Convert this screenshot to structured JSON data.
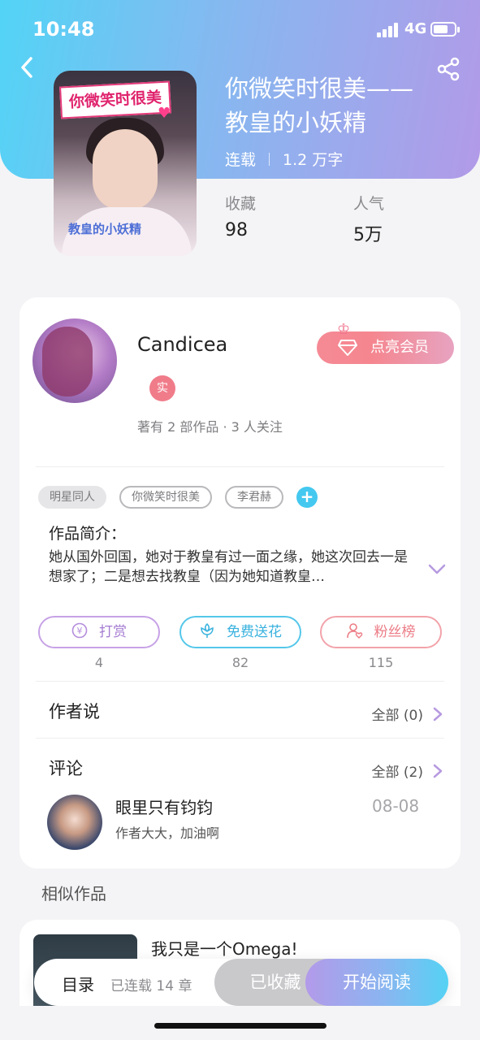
{
  "status_bar": {
    "time": "10:48",
    "network": "4G"
  },
  "book": {
    "title": "你微笑时很美——教皇的小妖精",
    "cover_banner": "你微笑时很美",
    "cover_subtitle": "教皇的小妖精",
    "status": "连载",
    "word_count": "1.2 万字",
    "stats": [
      {
        "label": "收藏",
        "value": "98"
      },
      {
        "label": "人气",
        "value": "5万"
      }
    ]
  },
  "author": {
    "name": "Candicea",
    "badge": "实",
    "info": "著有 2 部作品 · 3 人关注",
    "vip_button": "点亮会员"
  },
  "tags": [
    "明星同人",
    "你微笑时很美",
    "李君赫"
  ],
  "tag_add": "+",
  "intro": {
    "label": "作品简介：",
    "text": "她从国外回国，她对于教皇有过一面之缘，她这次回去一是想家了；二是想去找教皇（因为她知道教皇…"
  },
  "actions": [
    {
      "label": "打赏",
      "count": "4",
      "icon": "yen-icon"
    },
    {
      "label": "免费送花",
      "count": "82",
      "icon": "flower-icon"
    },
    {
      "label": "粉丝榜",
      "count": "115",
      "icon": "user-heart-icon"
    }
  ],
  "author_says": {
    "title": "作者说",
    "more": "全部 (0)"
  },
  "comments": {
    "title": "评论",
    "more": "全部 (2)",
    "items": [
      {
        "user": "眼里只有钧钧",
        "text": "作者大大，加油啊",
        "date": "08-08"
      }
    ]
  },
  "similar": {
    "title": "相似作品",
    "items": [
      {
        "title": "我只是一个Omega!"
      }
    ]
  },
  "bottom_bar": {
    "toc": "目录",
    "chapters": "已连载 14 章",
    "favorited": "已收藏",
    "read": "开始阅读"
  },
  "colors": {
    "hero_gradient_start": "#52d4f6",
    "hero_gradient_end": "#b29ae8",
    "vip": "#f58a95",
    "accent_cyan": "#44c8f0",
    "accent_purple": "#a47bd2"
  }
}
